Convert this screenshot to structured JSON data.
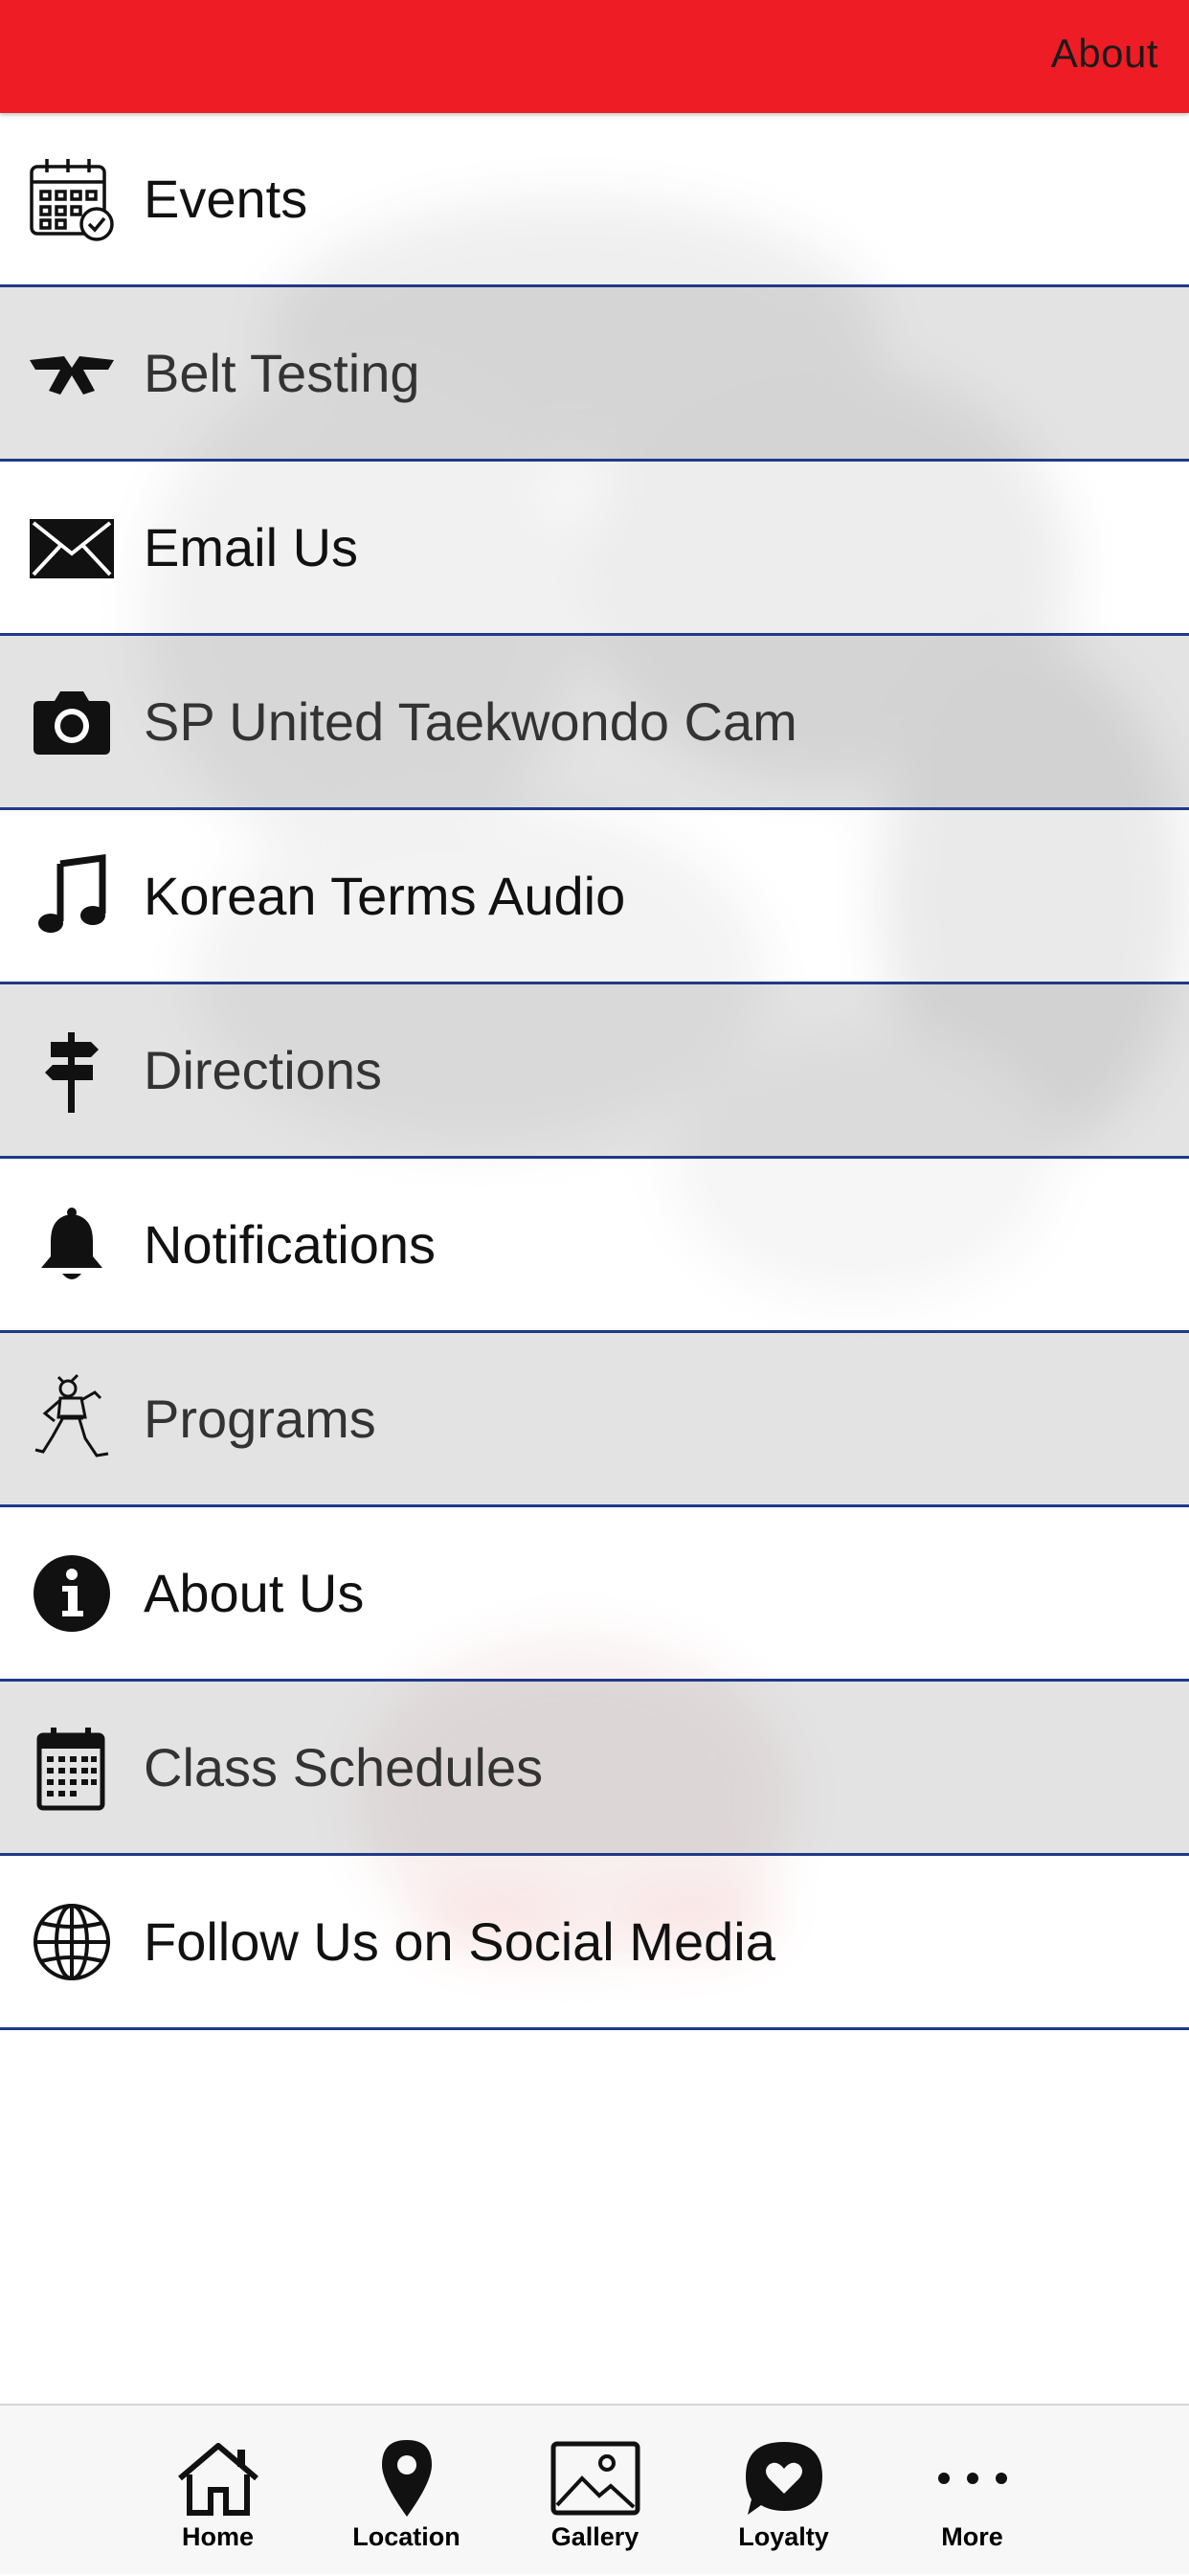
{
  "header": {
    "link_label": "About",
    "bg_color": "#ee1c25"
  },
  "menu": {
    "divider_color": "#1f3a8a",
    "items": [
      {
        "label": "Events",
        "icon": "calendar-check-icon"
      },
      {
        "label": "Belt Testing",
        "icon": "belt-icon"
      },
      {
        "label": "Email Us",
        "icon": "envelope-icon"
      },
      {
        "label": "SP United Taekwondo Cam",
        "icon": "camera-icon"
      },
      {
        "label": "Korean Terms Audio",
        "icon": "music-note-icon"
      },
      {
        "label": "Directions",
        "icon": "signpost-icon"
      },
      {
        "label": "Notifications",
        "icon": "bell-icon"
      },
      {
        "label": "Programs",
        "icon": "martial-artist-icon"
      },
      {
        "label": "About Us",
        "icon": "info-icon"
      },
      {
        "label": "Class Schedules",
        "icon": "calendar-icon"
      },
      {
        "label": "Follow Us on Social Media",
        "icon": "globe-icon"
      }
    ]
  },
  "tabbar": {
    "tabs": [
      {
        "label": "Home",
        "icon": "home-icon"
      },
      {
        "label": "Location",
        "icon": "location-pin-icon"
      },
      {
        "label": "Gallery",
        "icon": "gallery-image-icon"
      },
      {
        "label": "Loyalty",
        "icon": "loyalty-heart-icon"
      },
      {
        "label": "More",
        "icon": "more-dots-icon"
      }
    ]
  }
}
